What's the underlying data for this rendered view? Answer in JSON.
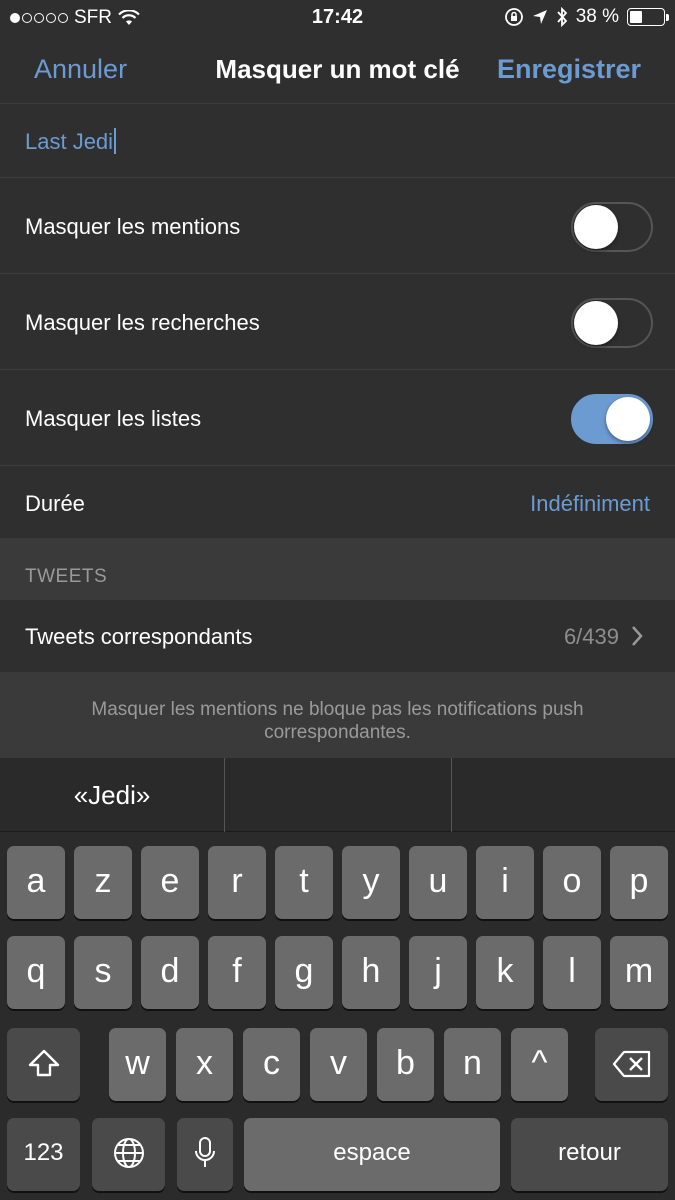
{
  "status": {
    "carrier": "SFR",
    "time": "17:42",
    "battery_percent": "38 %",
    "battery_level": 0.38,
    "signal_bars_filled": 1,
    "signal_bars_total": 5
  },
  "nav": {
    "cancel_label": "Annuler",
    "title": "Masquer un mot clé",
    "save_label": "Enregistrer"
  },
  "keyword": {
    "value": "Last Jedi"
  },
  "settings": {
    "mentions": {
      "label": "Masquer les mentions",
      "on": false
    },
    "searches": {
      "label": "Masquer les recherches",
      "on": false
    },
    "lists": {
      "label": "Masquer les listes",
      "on": true
    },
    "duration": {
      "label": "Durée",
      "value": "Indéfiniment"
    }
  },
  "tweets_section": {
    "header": "TWEETS",
    "row_label": "Tweets correspondants",
    "count": "6/439"
  },
  "footer_note": "Masquer les mentions ne bloque pas les notifications push correspondantes.",
  "keyboard": {
    "suggestions": [
      "«Jedi»",
      "",
      ""
    ],
    "row1": [
      "a",
      "z",
      "e",
      "r",
      "t",
      "y",
      "u",
      "i",
      "o",
      "p"
    ],
    "row2": [
      "q",
      "s",
      "d",
      "f",
      "g",
      "h",
      "j",
      "k",
      "l",
      "m"
    ],
    "row3": [
      "w",
      "x",
      "c",
      "v",
      "b",
      "n",
      "^"
    ],
    "numbers_label": "123",
    "space_label": "espace",
    "return_label": "retour"
  },
  "colors": {
    "accent": "#6c9bd2",
    "background": "#2f2f2f",
    "section_background": "#3a3a3a",
    "key": "#6b6b6b",
    "special_key": "#4a4a4a"
  }
}
